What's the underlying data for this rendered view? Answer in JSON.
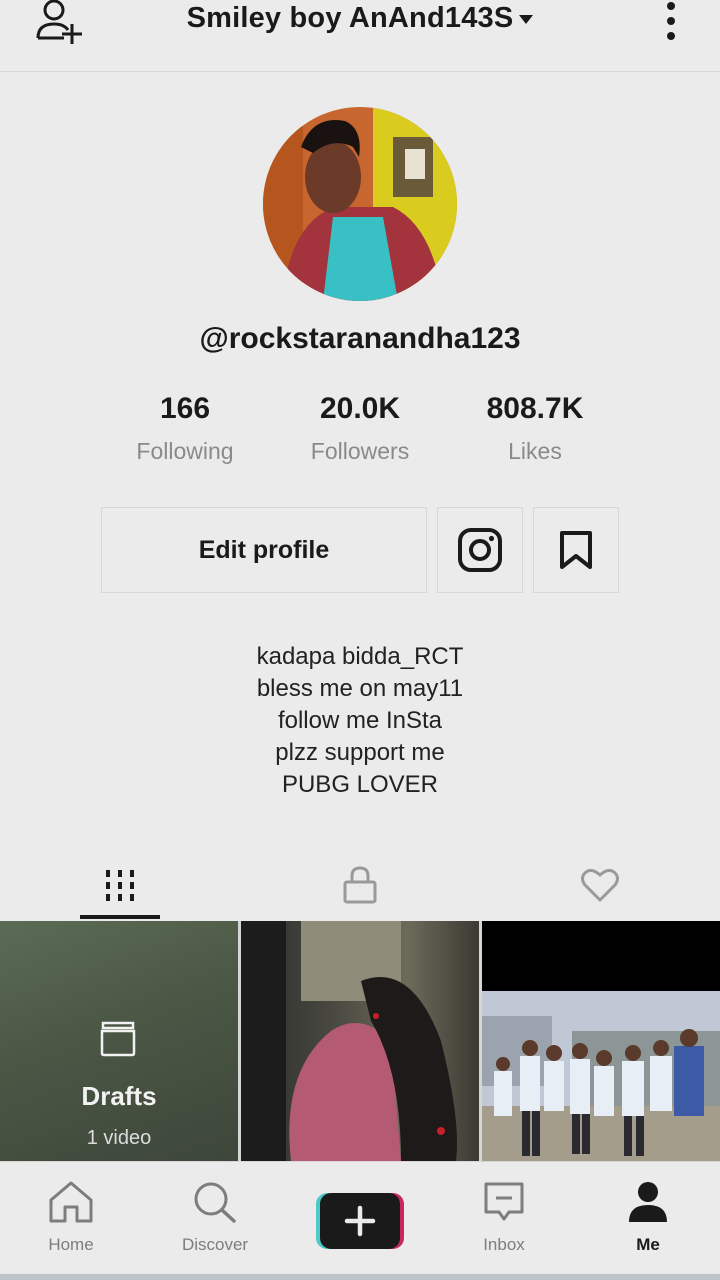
{
  "header": {
    "title": "Smiley boy AnAnd143S"
  },
  "profile": {
    "handle": "@rockstaranandha123",
    "stats": [
      {
        "value": "166",
        "label": "Following"
      },
      {
        "value": "20.0K",
        "label": "Followers"
      },
      {
        "value": "808.7K",
        "label": "Likes"
      }
    ],
    "edit_label": "Edit profile",
    "bio": [
      "kadapa bidda_RCT",
      "bless me on may11",
      "follow me InSta",
      "plzz support me",
      "PUBG LOVER"
    ]
  },
  "grid": {
    "drafts_label": "Drafts",
    "drafts_count": "1 video"
  },
  "bottom_nav": [
    {
      "label": "Home",
      "icon": "home-icon"
    },
    {
      "label": "Discover",
      "icon": "search-icon"
    },
    {
      "label": "",
      "icon": "plus-icon"
    },
    {
      "label": "Inbox",
      "icon": "inbox-icon"
    },
    {
      "label": "Me",
      "icon": "person-icon"
    }
  ],
  "icons": [
    "add-user-icon",
    "caret-down-icon",
    "more-vertical-icon",
    "instagram-icon",
    "bookmark-icon",
    "grid-icon",
    "lock-icon",
    "heart-icon",
    "drafts-icon"
  ]
}
